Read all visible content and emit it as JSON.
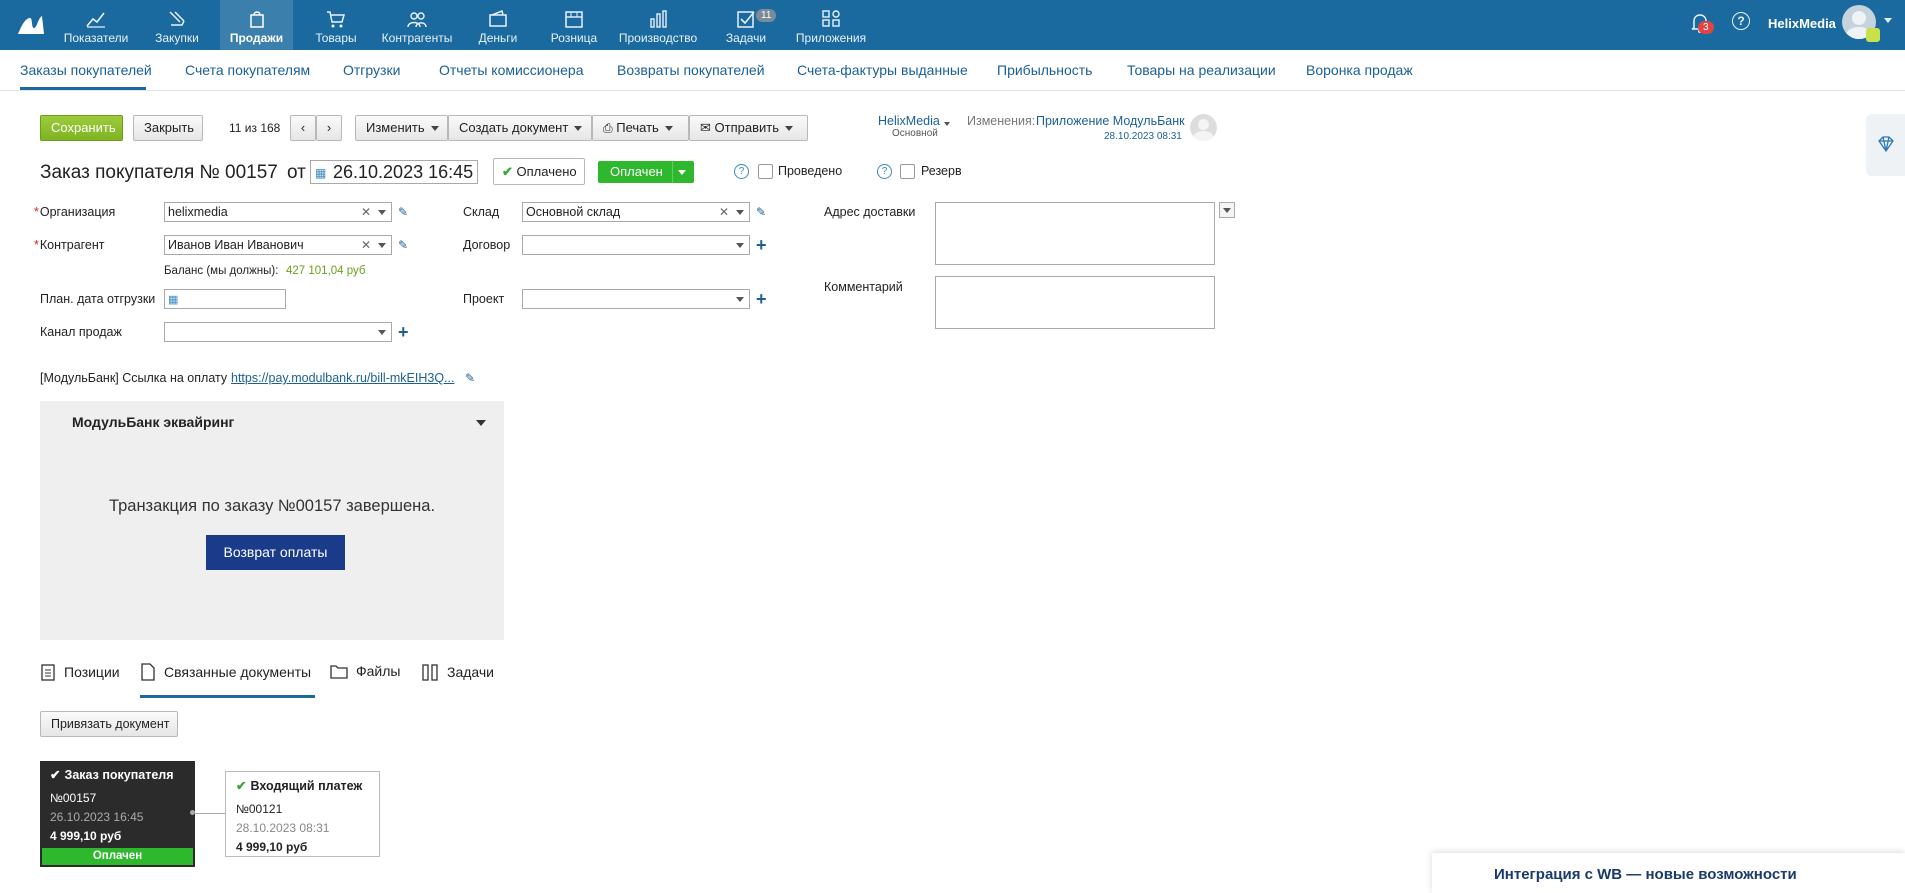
{
  "topnav": {
    "items": [
      {
        "label": "Показатели"
      },
      {
        "label": "Закупки"
      },
      {
        "label": "Продажи"
      },
      {
        "label": "Товары"
      },
      {
        "label": "Контрагенты"
      },
      {
        "label": "Деньги"
      },
      {
        "label": "Розница"
      },
      {
        "label": "Производство"
      },
      {
        "label": "Задачи"
      },
      {
        "label": "Приложения"
      }
    ],
    "tasks_badge": "11",
    "notifications_badge": "3",
    "username": "HelixMedia"
  },
  "subnav": [
    "Заказы покупателей",
    "Счета покупателям",
    "Отгрузки",
    "Отчеты комиссионера",
    "Возвраты покупателей",
    "Счета-фактуры выданные",
    "Прибыльность",
    "Товары на реализации",
    "Воронка продаж"
  ],
  "toolbar": {
    "save": "Сохранить",
    "close": "Закрыть",
    "pager": "11 из 168",
    "change": "Изменить",
    "create_doc": "Создать документ",
    "print": "Печать",
    "send": "Отправить",
    "owner": "HelixMedia",
    "owner_sub": "Основной",
    "changes_label": "Изменения:",
    "changes_value": "Приложение МодульБанк",
    "changes_date": "28.10.2023 08:31"
  },
  "header": {
    "title": "Заказ покупателя №",
    "number": "00157",
    "from": "от",
    "date": "26.10.2023 16:45",
    "paid_badge": "Оплачено",
    "status": "Оплачен",
    "posted": "Проведено",
    "reserve": "Резерв"
  },
  "form": {
    "org_label": "Организация",
    "org_value": "helixmedia",
    "counterparty_label": "Контрагент",
    "counterparty_value": "Иванов Иван Иванович",
    "balance_label": "Баланс (мы должны):",
    "balance_value": "427 101,04 руб",
    "ship_date_label": "План. дата отгрузки",
    "channel_label": "Канал продаж",
    "warehouse_label": "Склад",
    "warehouse_value": "Основной склад",
    "contract_label": "Договор",
    "project_label": "Проект",
    "address_label": "Адрес доставки",
    "comment_label": "Комментарий",
    "link_label": "[МодульБанк] Ссылка на оплату",
    "link_value": "https://pay.modulbank.ru/bill-mkEIH3Q..."
  },
  "widget": {
    "title": "МодульБанк эквайринг",
    "message": "Транзакция по заказу №00157 завершена.",
    "refund": "Возврат оплаты"
  },
  "tabs": [
    "Позиции",
    "Связанные документы",
    "Файлы",
    "Задачи"
  ],
  "bind_button": "Привязать документ",
  "cards": [
    {
      "title": "Заказ покупателя",
      "number": "№00157",
      "date": "26.10.2023 16:45",
      "sum": "4 999,10 руб",
      "status": "Оплачен"
    },
    {
      "title": "Входящий платеж",
      "number": "№00121",
      "date": "28.10.2023 08:31",
      "sum": "4 999,10 руб"
    }
  ],
  "promo": "Интеграция с WB — новые возможности",
  "colors": {
    "topbar": "#1a6aa0",
    "accent_green": "#2db82d",
    "refund_button": "#1a3a8a",
    "balance": "#6aa01e"
  }
}
